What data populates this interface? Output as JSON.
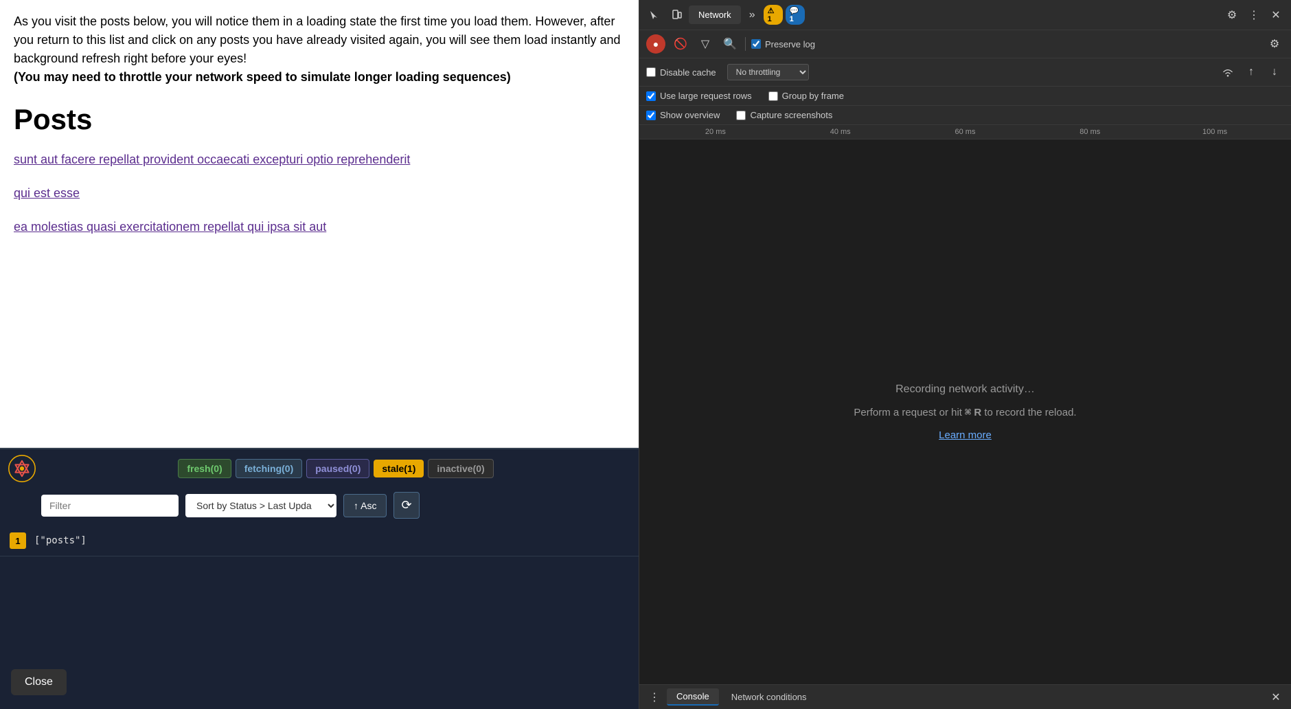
{
  "page": {
    "description": "As you visit the posts below, you will notice them in a loading state the first time you load them. However, after you return to this list and click on any posts you have already visited again, you will see them load instantly and background refresh right before your eyes!",
    "description_bold": "(You may need to throttle your network speed to simulate longer loading sequences)",
    "posts_title": "Posts",
    "links": [
      {
        "text": "sunt aut facere repellat provident occaecati excepturi optio reprehenderit"
      },
      {
        "text": "qui est esse"
      },
      {
        "text": "ea molestias quasi exercitationem repellat qui ipsa sit aut"
      }
    ]
  },
  "devtools": {
    "logo_alt": "React Query Logo",
    "badges": [
      {
        "label": "fresh(0)",
        "type": "fresh"
      },
      {
        "label": "fetching(0)",
        "type": "fetching"
      },
      {
        "label": "paused(0)",
        "type": "paused"
      },
      {
        "label": "stale(1)",
        "type": "stale"
      },
      {
        "label": "inactive(0)",
        "type": "inactive"
      }
    ],
    "filter_placeholder": "Filter",
    "sort_label": "Sort by Status > Last Upda",
    "asc_label": "↑ Asc",
    "queries": [
      {
        "number": "1",
        "key": "[\"posts\"]"
      }
    ]
  },
  "close_button": "Close",
  "network_panel": {
    "tabs": [
      {
        "label": "Network",
        "active": true
      },
      {
        "label": "More",
        "icon": ">>"
      }
    ],
    "warning_badge": "⚠ 1",
    "info_badge": "💬 1",
    "toolbar": {
      "preserve_log_label": "Preserve log",
      "disable_cache_label": "Disable cache",
      "throttle_label": "No throttling"
    },
    "options": [
      {
        "label": "Use large request rows",
        "checked": true
      },
      {
        "label": "Group by frame",
        "checked": false
      }
    ],
    "options2": [
      {
        "label": "Show overview",
        "checked": true
      },
      {
        "label": "Capture screenshots",
        "checked": false
      }
    ],
    "timeline_ticks": [
      "20 ms",
      "40 ms",
      "60 ms",
      "80 ms",
      "100 ms"
    ],
    "recording": {
      "line1": "Recording network activity…",
      "line2": "Perform a request or hit ⌘ R to record the reload.",
      "learn_more": "Learn more"
    },
    "bottom_tabs": [
      {
        "label": "Console",
        "active": true
      },
      {
        "label": "Network conditions",
        "active": false
      }
    ]
  }
}
